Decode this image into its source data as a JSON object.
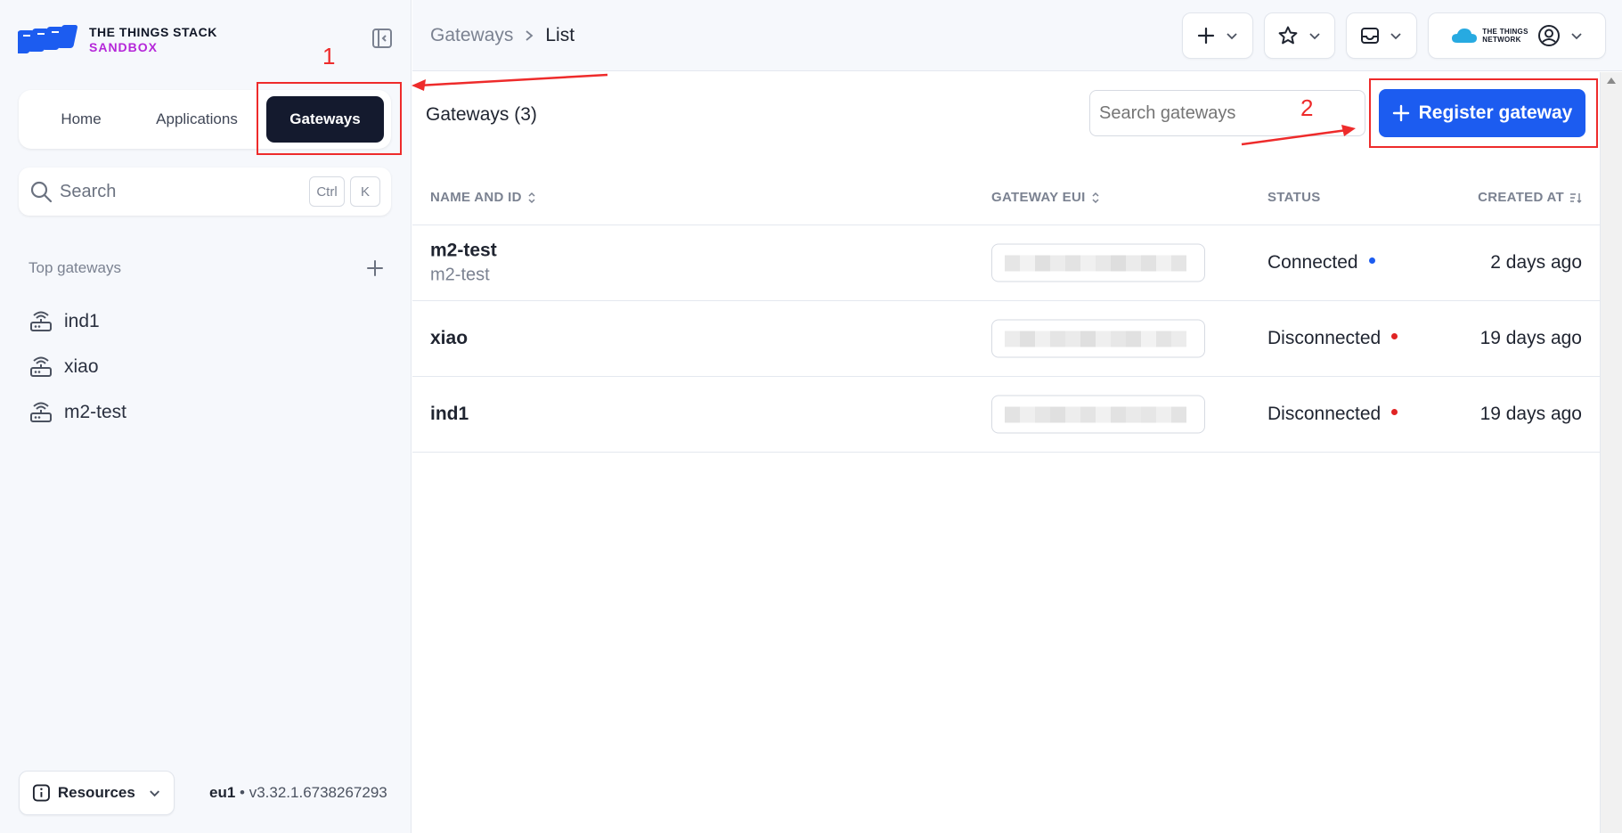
{
  "app": {
    "logo_title": "THE THINGS STACK",
    "logo_subtitle": "SANDBOX"
  },
  "nav": {
    "tabs": [
      {
        "label": "Home",
        "active": false
      },
      {
        "label": "Applications",
        "active": false
      },
      {
        "label": "Gateways",
        "active": true
      }
    ]
  },
  "sidebar_search": {
    "placeholder": "Search",
    "shortcut_keys": [
      "Ctrl",
      "K"
    ]
  },
  "top_gateways": {
    "title": "Top gateways",
    "items": [
      "ind1",
      "xiao",
      "m2-test"
    ]
  },
  "footer": {
    "resources_label": "Resources",
    "region": "eu1",
    "version": "v3.32.1.6738267293"
  },
  "header": {
    "breadcrumb": [
      "Gateways",
      "List"
    ],
    "user_logo_text": [
      "THE THINGS",
      "NETWORK"
    ]
  },
  "main": {
    "title": "Gateways (3)",
    "search_placeholder": "Search gateways",
    "register_label": "Register gateway",
    "table": {
      "columns": [
        "NAME AND ID",
        "GATEWAY EUI",
        "STATUS",
        "CREATED AT"
      ],
      "rows": [
        {
          "name": "m2-test",
          "id": "m2-test",
          "status": "Connected",
          "status_color": "#1c5cf0",
          "created": "2 days ago"
        },
        {
          "name": "xiao",
          "id": "",
          "status": "Disconnected",
          "status_color": "#e02424",
          "created": "19 days ago"
        },
        {
          "name": "ind1",
          "id": "",
          "status": "Disconnected",
          "status_color": "#e02424",
          "created": "19 days ago"
        }
      ]
    }
  },
  "annotations": {
    "step1": "1",
    "step2": "2",
    "color": "#ee2b2b"
  },
  "colors": {
    "primary": "#1c5cf0",
    "nav_active": "#141a2e",
    "brand_accent": "#b527d9"
  }
}
